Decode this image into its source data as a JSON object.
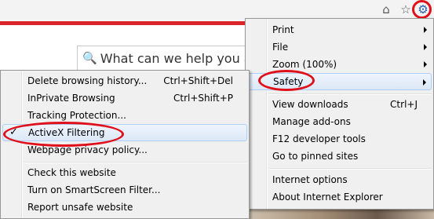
{
  "browser": {
    "home_icon": "home-icon",
    "favorites_icon": "star-icon",
    "tools_icon": "gear-icon",
    "accent_color": "#d8262b",
    "annotation_color": "#e0101a"
  },
  "page": {
    "search_placeholder": "What can we help you a"
  },
  "tools_menu": {
    "items": [
      {
        "label": "Print",
        "submenu": true
      },
      {
        "label": "File",
        "submenu": true
      },
      {
        "label": "Zoom (100%)",
        "submenu": true
      },
      {
        "label": "Safety",
        "submenu": true,
        "highlighted": true
      },
      {
        "label": "View downloads",
        "shortcut": "Ctrl+J"
      },
      {
        "label": "Manage add-ons"
      },
      {
        "label": "F12 developer tools"
      },
      {
        "label": "Go to pinned sites"
      },
      {
        "label": "Internet options"
      },
      {
        "label": "About Internet Explorer"
      }
    ]
  },
  "safety_menu": {
    "items": [
      {
        "label": "Delete browsing history...",
        "shortcut": "Ctrl+Shift+Del"
      },
      {
        "label": "InPrivate Browsing",
        "shortcut": "Ctrl+Shift+P"
      },
      {
        "label": "Tracking Protection..."
      },
      {
        "label": "ActiveX Filtering",
        "checked": true,
        "highlighted": true,
        "check_mark": "✓"
      },
      {
        "label": "Webpage privacy policy..."
      },
      {
        "label": "Check this website"
      },
      {
        "label": "Turn on SmartScreen Filter..."
      },
      {
        "label": "Report unsafe website"
      }
    ]
  }
}
